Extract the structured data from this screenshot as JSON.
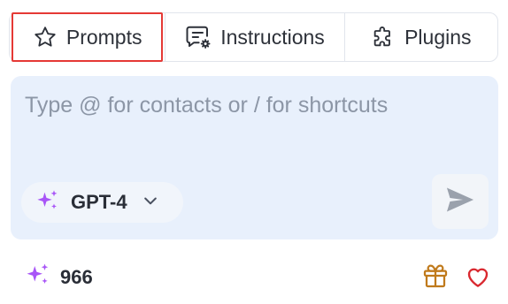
{
  "tabs": [
    {
      "label": "Prompts",
      "icon": "star-icon",
      "selected": true
    },
    {
      "label": "Instructions",
      "icon": "message-settings-icon",
      "selected": false
    },
    {
      "label": "Plugins",
      "icon": "puzzle-icon",
      "selected": false
    }
  ],
  "composer": {
    "placeholder": "Type @ for contacts or / for shortcuts",
    "value": "",
    "model": {
      "label": "GPT-4",
      "icon": "sparkles-icon"
    },
    "send_icon": "send-icon"
  },
  "footer": {
    "credits": "966",
    "credits_icon": "sparkles-icon",
    "gift_icon": "gift-icon",
    "heart_icon": "heart-icon"
  },
  "colors": {
    "selection_outline": "#e53935",
    "card_background": "#e8f0fc",
    "sparkle": "#a855f7",
    "gift": "#c07a1c",
    "heart": "#d9282f"
  }
}
